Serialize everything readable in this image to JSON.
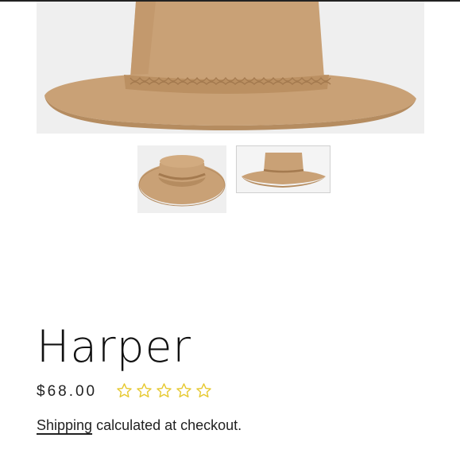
{
  "product": {
    "title": "Harper",
    "price": "$68.00",
    "rating_stars": 5,
    "rating_filled": 0,
    "star_color": "#e6c82e",
    "hat_color": "#c9a176",
    "hat_shadow": "#b58c60",
    "image_bg": "#efefef"
  },
  "shipping": {
    "link_text": "Shipping",
    "rest_text": " calculated at checkout."
  },
  "gallery": {
    "thumbnails": [
      {
        "name": "hat-front-view",
        "selected": false
      },
      {
        "name": "hat-side-view",
        "selected": true
      }
    ]
  }
}
